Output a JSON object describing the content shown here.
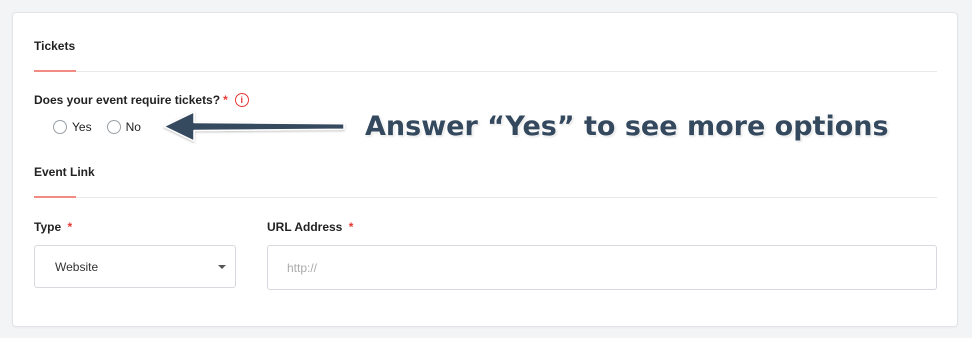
{
  "tickets": {
    "title": "Tickets",
    "question": "Does your event require tickets?",
    "required_mark": "*",
    "info_icon": "info-circle-icon",
    "options": [
      {
        "label": "Yes",
        "selected": false
      },
      {
        "label": "No",
        "selected": false
      }
    ]
  },
  "event_link": {
    "title": "Event Link",
    "type_label": "Type",
    "type_required": "*",
    "type_value": "Website",
    "url_label": "URL Address",
    "url_required": "*",
    "url_value": "",
    "url_placeholder": "http://"
  },
  "annotation": {
    "text": "Answer “Yes” to see more options",
    "color": "#34495e"
  },
  "colors": {
    "accent": "#f28b82",
    "required": "#e53935",
    "annotation": "#34495e"
  }
}
